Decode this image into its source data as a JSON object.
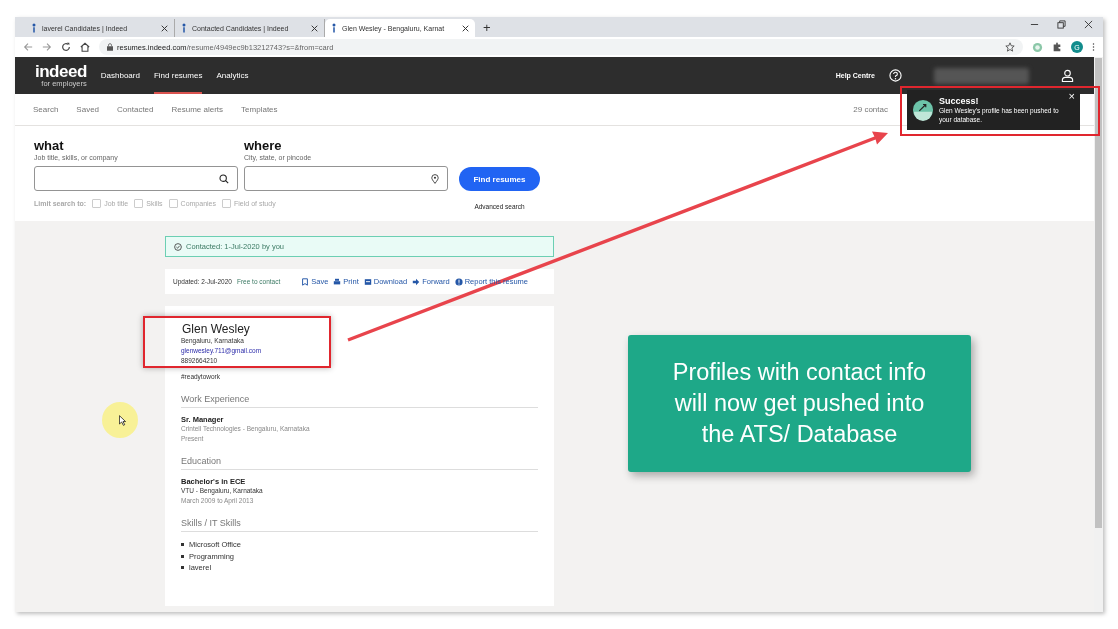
{
  "browser": {
    "tabs": [
      {
        "title": "laverel Candidates | Indeed",
        "selected": false
      },
      {
        "title": "Contacted Candidates | Indeed",
        "selected": false
      },
      {
        "title": "Glen Wesley - Bengaluru, Karnat",
        "selected": true
      }
    ],
    "new_tab": "+",
    "url_host": "resumes.indeed.com",
    "url_path": "/resume/4949ec9b13212743?s=&from=card",
    "profile_initial": "G"
  },
  "nav": {
    "logo": "indeed",
    "logo_sub": "for employers",
    "items": [
      {
        "label": "Dashboard",
        "selected": false
      },
      {
        "label": "Find resumes",
        "selected": true
      },
      {
        "label": "Analytics",
        "selected": false
      }
    ],
    "help": "Help Centre"
  },
  "subnav": {
    "items": [
      "Search",
      "Saved",
      "Contacted",
      "Resume alerts",
      "Templates"
    ],
    "count": "29 contac"
  },
  "search": {
    "what_label": "what",
    "what_hint": "Job title, skills, or company",
    "where_label": "where",
    "where_hint": "City, state, or pincode",
    "button": "Find resumes",
    "limit_label": "Limit search to:",
    "filters": [
      {
        "label": "Job title",
        "checked": false
      },
      {
        "label": "Skills",
        "checked": false
      },
      {
        "label": "Companies",
        "checked": false
      },
      {
        "label": "Field of study",
        "checked": false
      }
    ],
    "advanced": "Advanced search"
  },
  "contacted_banner": "Contacted: 1-Jul-2020 by you",
  "action_bar": {
    "updated": "Updated: 2-Jul-2020",
    "status": "Free to contact",
    "actions": [
      {
        "kind": "save",
        "label": "Save"
      },
      {
        "kind": "print",
        "label": "Print"
      },
      {
        "kind": "download",
        "label": "Download"
      },
      {
        "kind": "forward",
        "label": "Forward"
      },
      {
        "kind": "report",
        "label": "Report this resume"
      }
    ]
  },
  "resume": {
    "name": "Glen Wesley",
    "location": "Bengaluru, Karnataka",
    "email": "glenwesley.711@gmail.com",
    "phone": "8892664210",
    "tag": "#readytowork",
    "sections": [
      {
        "title": "Work Experience",
        "kind": "entries",
        "entries": [
          {
            "heading": "Sr. Manager",
            "lines": [
              "Crintell Technologies  -  Bengaluru, Karnataka",
              "Present"
            ]
          }
        ]
      },
      {
        "title": "Education",
        "kind": "entries",
        "entries": [
          {
            "heading": "Bachelor's in ECE",
            "lines": [
              "VTU  -  Bengaluru, Karnataka",
              "March 2009 to April 2013"
            ]
          }
        ]
      },
      {
        "title": "Skills / IT Skills",
        "kind": "list",
        "items": [
          "Microsoft Office",
          "Programming",
          "laverel"
        ]
      }
    ]
  },
  "toast": {
    "title": "Success!",
    "message": "Glen Wesley's profile has been pushed to your database.",
    "close": "×"
  },
  "callout": "Profiles with contact info will now get pushed into the ATS/ Database"
}
